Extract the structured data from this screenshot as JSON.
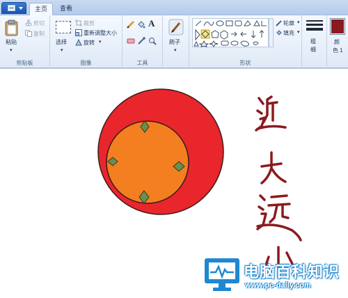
{
  "window": {
    "tabs": [
      {
        "label": "主页",
        "active": true
      },
      {
        "label": "查看",
        "active": false
      }
    ]
  },
  "ribbon": {
    "clipboard": {
      "paste_label": "粘贴",
      "cut_label": "剪切",
      "copy_label": "复制",
      "group_label": "剪贴板"
    },
    "image": {
      "select_label": "选择",
      "crop_label": "裁剪",
      "resize_label": "重新调整大小",
      "rotate_label": "旋转",
      "group_label": "图像"
    },
    "tools": {
      "group_label": "工具",
      "text_tool": "A"
    },
    "brushes": {
      "label": "刷子"
    },
    "shapes": {
      "outline_label": "轮廓",
      "fill_label": "填充",
      "group_label": "形状"
    },
    "size": {
      "label_line1": "粗",
      "label_line2": "细"
    },
    "color1": {
      "label_line1": "颜",
      "label_line2": "色 1",
      "value": "#8b1a1e"
    }
  },
  "canvas": {
    "handwriting": [
      "近",
      "大",
      "远",
      "小"
    ],
    "handwriting_color": "#8b1a1e",
    "outer_circle_color": "#e8262c",
    "inner_circle_color": "#f47f20",
    "diamond_color": "#6b8e4e"
  },
  "watermark": {
    "title": "电脑百科知识",
    "url": "www.pc-daily.com",
    "accent": "#1e88d2"
  }
}
